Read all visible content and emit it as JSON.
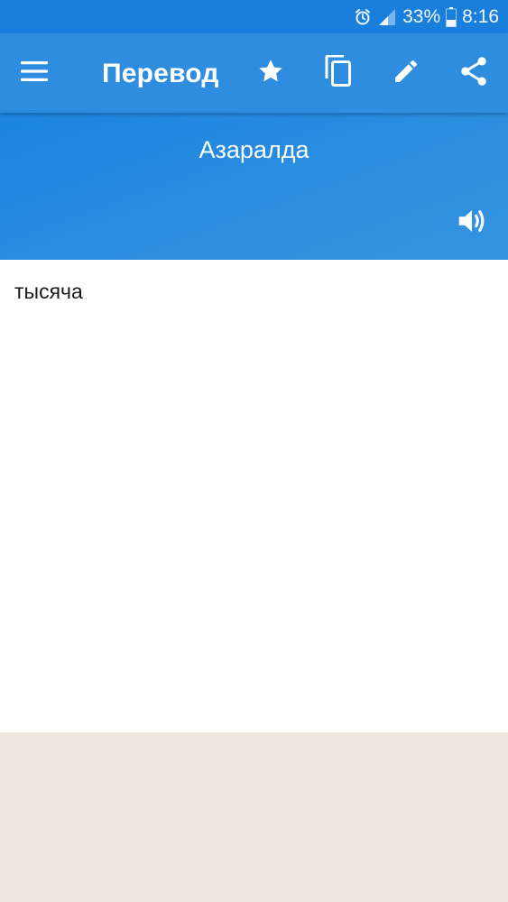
{
  "status_bar": {
    "battery_percent": "33%",
    "time": "8:16",
    "icons": [
      "alarm-icon",
      "signal-icon",
      "battery-icon"
    ]
  },
  "app_bar": {
    "title": "Перевод",
    "actions": [
      "menu-icon",
      "star-icon",
      "copy-icon",
      "edit-icon",
      "share-icon"
    ]
  },
  "source": {
    "text": "Азаралда",
    "speaker_icon": "speaker-icon"
  },
  "result": {
    "text": "тысяча"
  },
  "colors": {
    "status_bar": "#1a7fdc",
    "app_bar": "#2f8de0",
    "source_panel": "#2b8ee0",
    "result_bg": "#ffffff",
    "footer_bg": "#efe7df"
  }
}
